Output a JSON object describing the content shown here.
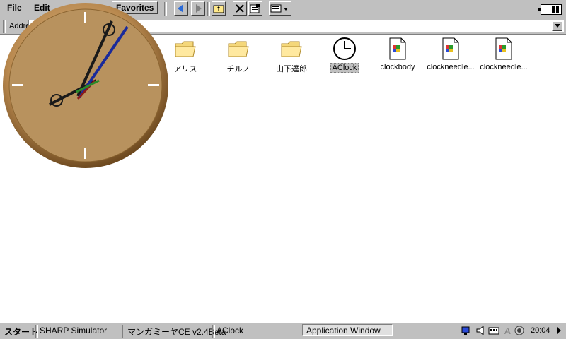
{
  "menubar": {
    "file": "File",
    "edit": "Edit",
    "favorites": "Favorites"
  },
  "address": {
    "label": "Address",
    "value": ""
  },
  "files": [
    {
      "label": "アリス",
      "icon": "folder-icon"
    },
    {
      "label": "チルノ",
      "icon": "folder-icon"
    },
    {
      "label": "山下達郎",
      "icon": "folder-icon"
    },
    {
      "label": "AClock",
      "icon": "clock-app-icon",
      "selected": true
    },
    {
      "label": "clockbody",
      "icon": "bitmap-file-icon"
    },
    {
      "label": "clockneedle...",
      "icon": "bitmap-file-icon"
    },
    {
      "label": "clockneedle...",
      "icon": "bitmap-file-icon"
    }
  ],
  "clock": {
    "hour": 8,
    "minute": 4,
    "face_color": "#b8925e",
    "rim_color": "#a87a40"
  },
  "taskbar": {
    "start": "スタート",
    "tasks": [
      "SHARP Simulator",
      "マンガミーヤCE v2.4Beta",
      "AClock",
      "Application Window"
    ],
    "time": "20:04"
  },
  "colors": {
    "chrome": "#c0c0c0",
    "background": "#ffffff"
  }
}
